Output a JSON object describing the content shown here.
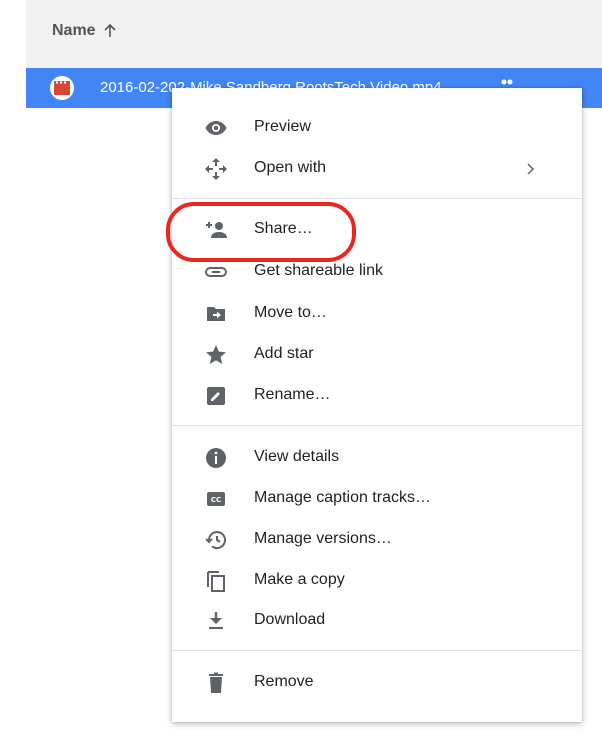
{
  "file_list": {
    "column_header": "Name",
    "sort_direction_icon": "arrow-up-icon",
    "selected_file": {
      "name": "2016-02-202-Mike Sandberg RootsTech Video.mp4",
      "type_icon": "video-file-icon",
      "shared_icon": "people-icon"
    }
  },
  "context_menu": {
    "items": [
      {
        "label": "Preview",
        "icon": "eye-icon"
      },
      {
        "label": "Open with",
        "icon": "move-arrows-icon",
        "submenu_icon": "chevron-right-icon"
      },
      {
        "label": "Share…",
        "icon": "person-add-icon"
      },
      {
        "label": "Get shareable link",
        "icon": "link-icon"
      },
      {
        "label": "Move to…",
        "icon": "folder-move-icon"
      },
      {
        "label": "Add star",
        "icon": "star-icon"
      },
      {
        "label": "Rename…",
        "icon": "pencil-icon"
      },
      {
        "label": "View details",
        "icon": "info-icon"
      },
      {
        "label": "Manage caption tracks…",
        "icon": "closed-caption-icon"
      },
      {
        "label": "Manage versions…",
        "icon": "history-icon"
      },
      {
        "label": "Make a copy",
        "icon": "copy-icon"
      },
      {
        "label": "Download",
        "icon": "download-icon"
      },
      {
        "label": "Remove",
        "icon": "trash-icon"
      }
    ]
  },
  "colors": {
    "selection_blue": "#4285f4",
    "highlight_red": "#e8271f",
    "icon_gray": "#5f6368",
    "file_icon_red": "#db4437"
  }
}
